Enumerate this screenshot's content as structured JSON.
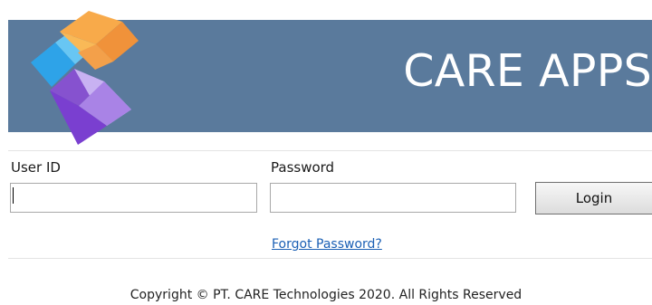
{
  "header": {
    "title": "CARE APPS",
    "background_color": "#5a7a9c",
    "logo_icon": "stacked-cubes-logo"
  },
  "form": {
    "user_id_label": "User ID",
    "user_id_value": "",
    "password_label": "Password",
    "password_value": "",
    "login_label": "Login"
  },
  "links": {
    "forgot_password": "Forgot Password?",
    "link_color": "#1a5fb4"
  },
  "footer": {
    "copyright": "Copyright © PT. CARE Technologies 2020. All Rights Reserved"
  }
}
